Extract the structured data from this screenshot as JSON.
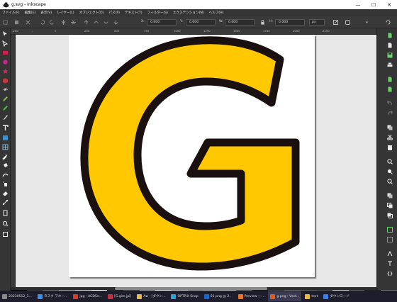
{
  "window": {
    "title": "g.svg - Inkscape",
    "minimize_glyph": "—",
    "maximize_glyph": "☐",
    "close_glyph": "✕"
  },
  "menu": {
    "items": [
      "ファイル(F)",
      "編集(E)",
      "表示(V)",
      "レイヤー(L)",
      "オブジェクト(O)",
      "パス(P)",
      "テキスト(T)",
      "フィルター(S)",
      "エクステンション(N)",
      "ヘルプ(H)"
    ]
  },
  "controls": {
    "x_label": "X:",
    "x_value": "0.000",
    "y_label": "Y:",
    "y_value": "0.000",
    "w_label": "W:",
    "w_value": "0.000",
    "h_label": "H:",
    "h_value": "0.000",
    "unit": "px"
  },
  "ruler": {
    "ticks": [
      "-250",
      "-",
      "0",
      "250",
      "500",
      "750",
      "1000",
      "1250",
      "1500",
      "1750",
      "2000",
      "2250"
    ]
  },
  "canvas": {
    "glyph": "G",
    "glyph_fill": "#FFC800",
    "glyph_stroke": "#1a1010"
  },
  "palette": [
    "#000000",
    "#333333",
    "#666666",
    "#999999",
    "#cccccc",
    "#ffffff",
    "#800000",
    "#ff0000",
    "#ff8000",
    "#ffff00",
    "#80ff00",
    "#00ff00",
    "#00ff80",
    "#00ffff",
    "#0080ff",
    "#0000ff",
    "#8000ff",
    "#ff00ff",
    "#ff0080",
    "#804000",
    "#ffc800",
    "#008080",
    "#400080",
    "#808000"
  ],
  "taskbar": {
    "items": [
      {
        "label": "20230512_1...",
        "color": "#888888"
      },
      {
        "label": "タスク マネー...",
        "color": "#3d8ee6"
      },
      {
        "label": "jpg・ACDSe...",
        "color": "#d83b2b"
      },
      {
        "label": "[G.gim.jpi]",
        "color": "#c2313f"
      },
      {
        "label": "Aw - [ダウン...",
        "color": "#e8b84a"
      },
      {
        "label": "OPTPiX Snap",
        "color": "#2aa1d6"
      },
      {
        "label": "01.png @ 2...",
        "color": "#1c64c6"
      },
      {
        "label": "Preview ---...",
        "color": "#e8742a"
      },
      {
        "label": "g.png・Vect...",
        "color": "#e05a20"
      },
      {
        "label": "test",
        "color": "#e8b84a"
      },
      {
        "label": "ダウンロード",
        "color": "#3d7fe6"
      }
    ]
  }
}
